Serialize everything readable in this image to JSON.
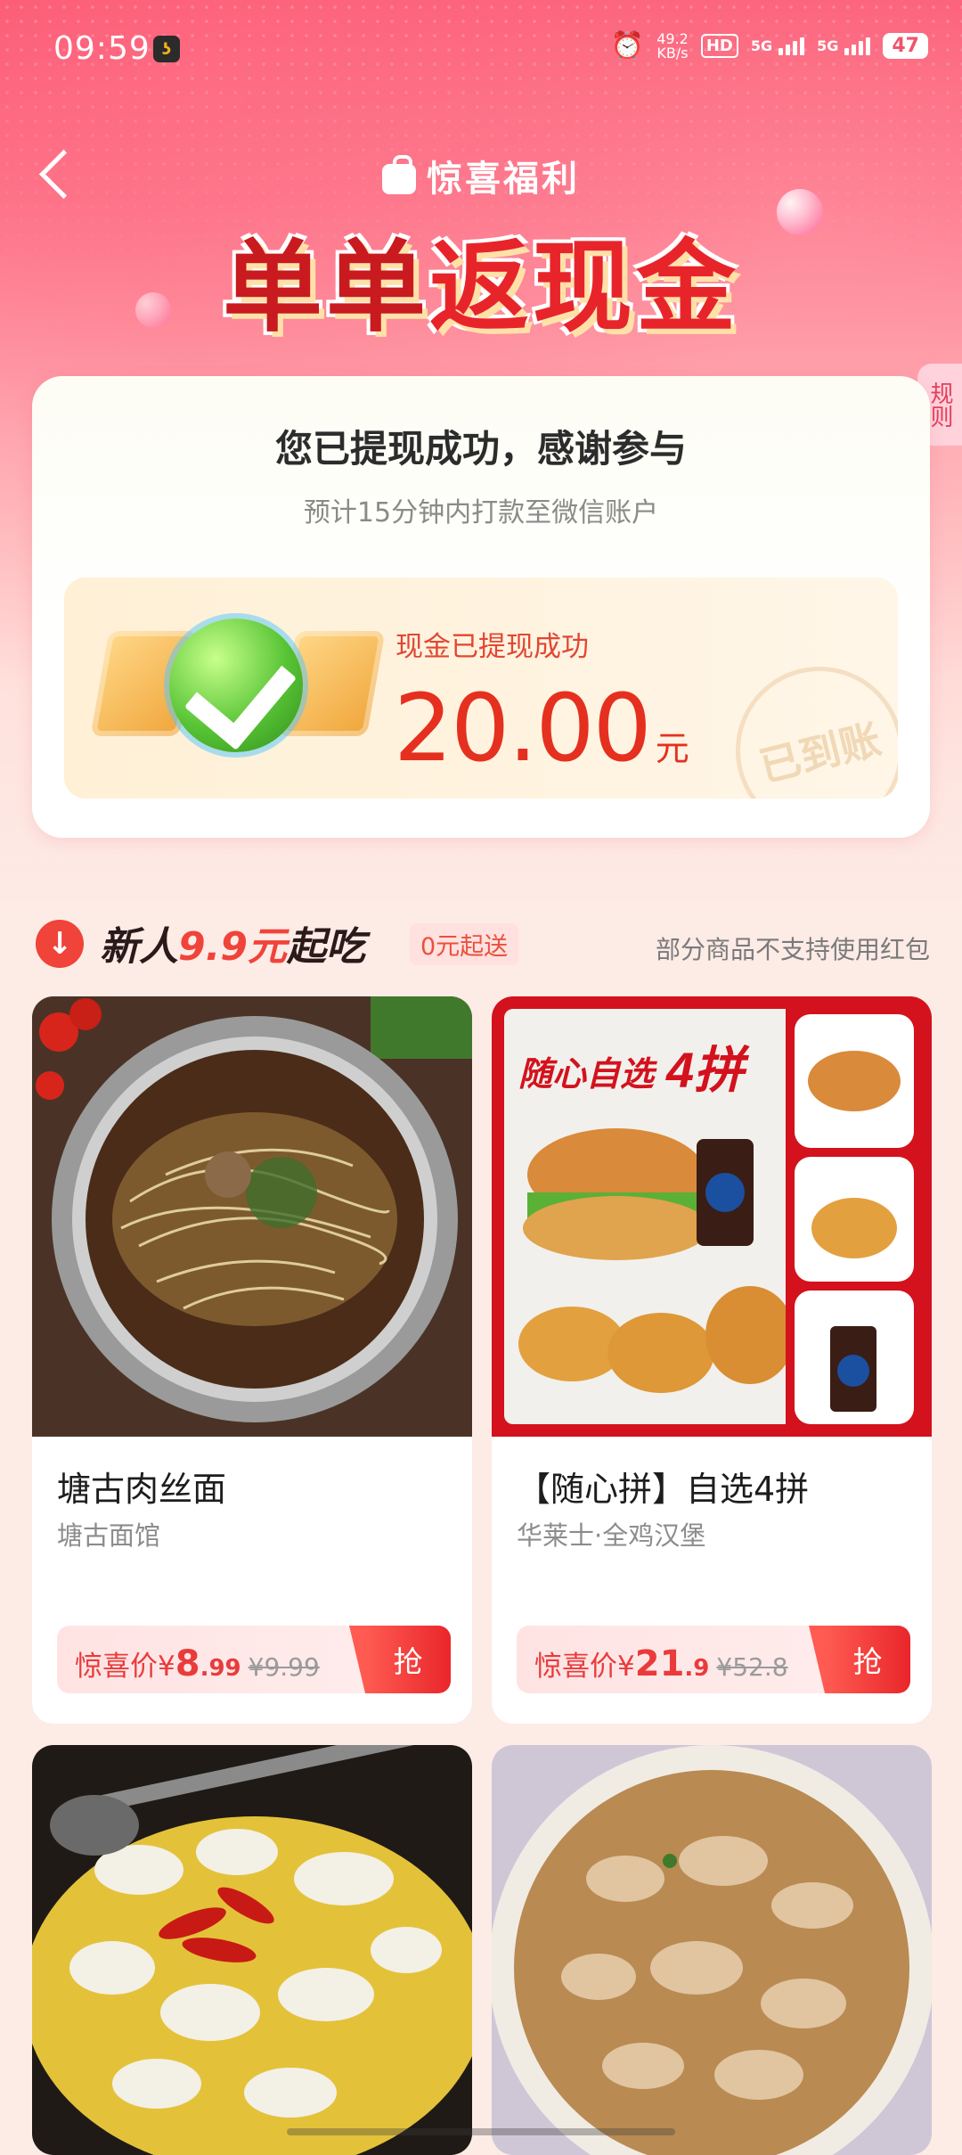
{
  "status_bar": {
    "time": "09:59",
    "net_speed_value": "49.2",
    "net_speed_unit": "KB/s",
    "hd": "HD",
    "sig1": "5G",
    "sig2": "5G",
    "battery": "47"
  },
  "header": {
    "brand": "惊喜福利",
    "headline_part1": "单单",
    "headline_part2": "返现金",
    "rules_tab": "规则"
  },
  "success_card": {
    "title": "您已提现成功，感谢参与",
    "subtitle": "预计15分钟内打款至微信账户",
    "cash_label": "现金已提现成功",
    "amount": "20.00",
    "unit": "元",
    "stamp": "已到账"
  },
  "section": {
    "title_prefix": "新人",
    "title_highlight": "9.9元",
    "title_suffix": "起吃",
    "tag": "0元起送",
    "note": "部分商品不支持使用红包"
  },
  "products": [
    {
      "name": "塘古肉丝面",
      "shop": "塘古面馆",
      "price_label": "惊喜价¥",
      "price_int": "8",
      "price_dec": ".99",
      "original": "¥9.99",
      "grab": "抢"
    },
    {
      "name": "【随心拼】自选4拼",
      "shop": "华莱士·全鸡汉堡",
      "price_label": "惊喜价¥",
      "price_int": "21",
      "price_dec": ".9",
      "original": "¥52.8",
      "grab": "抢"
    }
  ],
  "colors": {
    "accent_red": "#e5301f",
    "header_pink": "#fb4f6c",
    "grab_red": "#e9262b"
  }
}
